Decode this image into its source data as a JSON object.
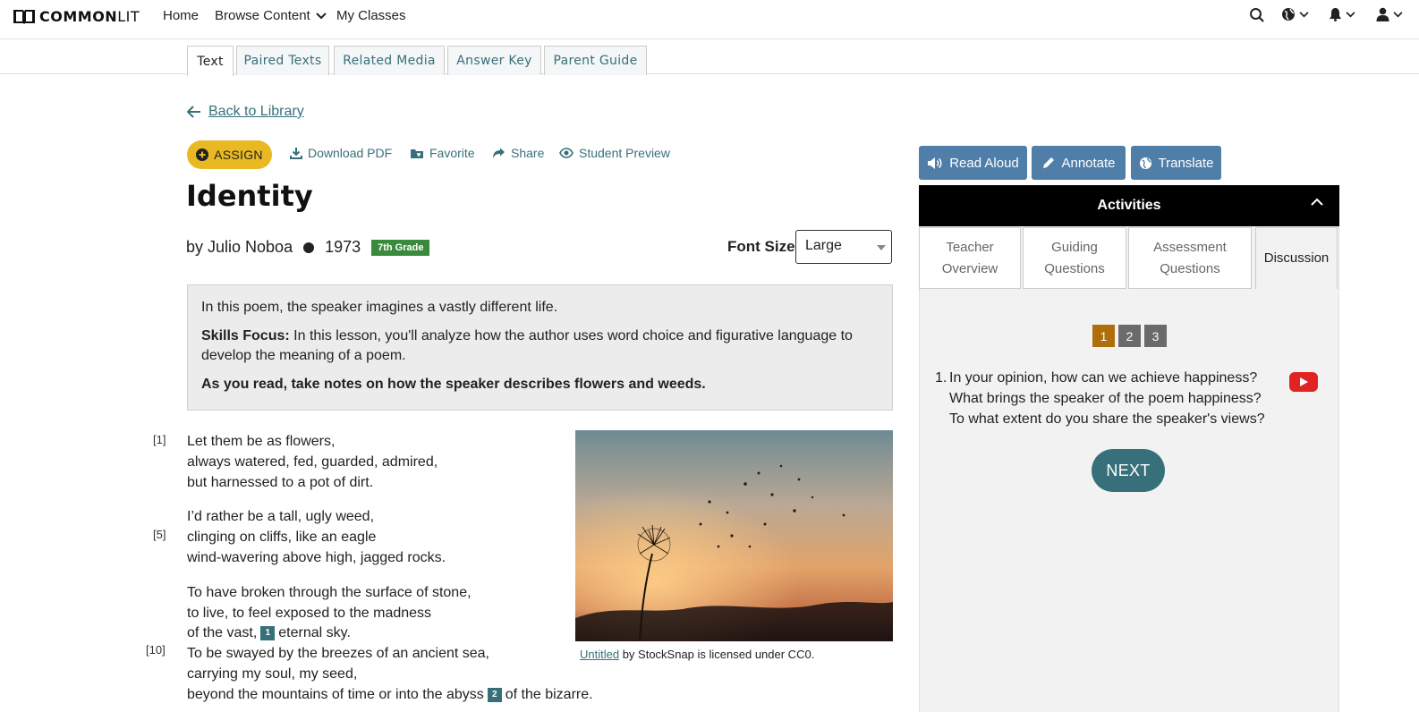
{
  "header": {
    "logo_bold": "COMMON",
    "logo_light": "LIT",
    "nav": [
      "Home",
      "Browse Content",
      "My Classes"
    ],
    "icons": [
      "search-icon",
      "globe-icon",
      "bell-icon",
      "user-icon"
    ]
  },
  "tabs": [
    "Text",
    "Paired Texts",
    "Related Media",
    "Answer Key",
    "Parent Guide"
  ],
  "back_link": "Back to Library",
  "actions": {
    "assign": "ASSIGN",
    "download": "Download PDF",
    "favorite": "Favorite",
    "share": "Share",
    "preview": "Student Preview"
  },
  "text": {
    "title": "Identity",
    "author": "by Julio Noboa",
    "year": "1973",
    "grade": "7th Grade"
  },
  "font_size": {
    "label": "Font Size",
    "value": "Large"
  },
  "intro": {
    "summary": "In this poem, the speaker imagines a vastly different life.",
    "skills_label": "Skills Focus:",
    "skills_text": " In this lesson, you'll analyze how the author uses word choice and figurative language to develop the meaning of a poem.",
    "as_you_read": "As you read, take notes on how the speaker describes flowers and weeds."
  },
  "poem": {
    "line_numbers": [
      "[1]",
      "[5]",
      "[10]"
    ],
    "lines": [
      "Let them be as flowers,",
      "always watered, fed, guarded, admired,",
      "but harnessed to a pot of dirt.",
      "I’d rather be a tall, ugly weed,",
      "clinging on cliffs, like an eagle",
      "wind-wavering above high, jagged rocks.",
      "To have broken through the surface of stone,",
      "to live, to feel exposed to the madness",
      "To be swayed by the breezes of an ancient sea,",
      "carrying my soul, my seed,"
    ],
    "line9_before": "of the vast,",
    "line9_after": "eternal sky.",
    "line12_before": "beyond the mountains of time or into the abyss",
    "line12_after": "of the bizarre.",
    "footnotes": [
      "1",
      "2"
    ]
  },
  "image_caption": {
    "link": "Untitled",
    "rest": " by StockSnap is licensed under CC0."
  },
  "panel": {
    "tools": [
      "Read Aloud",
      "Annotate",
      "Translate"
    ],
    "activities_title": "Activities",
    "tabs": [
      "Teacher Overview",
      "Guiding Questions",
      "Assessment Questions",
      "Discussion"
    ],
    "pages": [
      "1",
      "2",
      "3"
    ],
    "question_number": "1.",
    "question": "In your opinion, how can we achieve happiness? What brings the speaker of the poem happiness? To what extent do you share the speaker's views?",
    "next": "NEXT",
    "colors": {
      "active_page": "#b06d0c",
      "inactive_page": "#6b6b6b",
      "accent": "#37707b",
      "tool_blue": "#4f7ea8"
    }
  }
}
